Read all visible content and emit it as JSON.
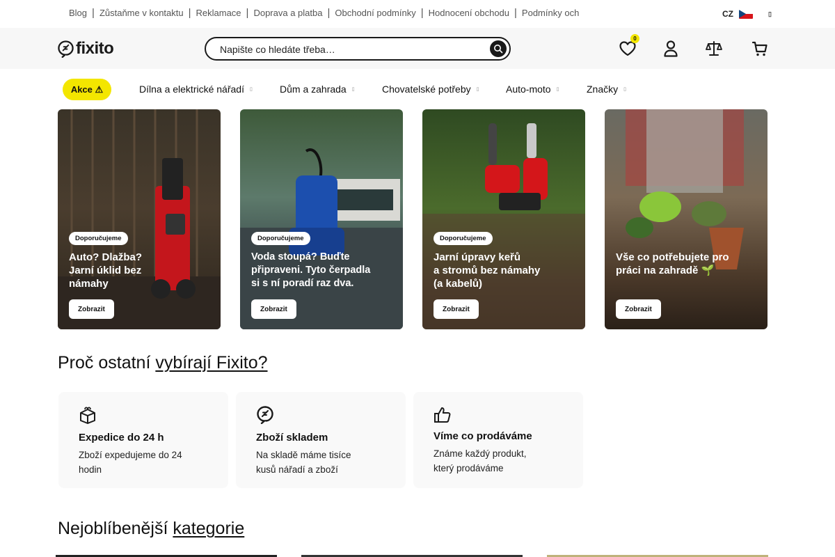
{
  "topbar": {
    "links": [
      "Blog",
      "Zůstaňme v kontaktu",
      "Reklamace",
      "Doprava a platba",
      "Obchodní podmínky",
      "Hodnocení obchodu",
      "Podmínky och"
    ],
    "lang": "CZ"
  },
  "header": {
    "logo": "fixito",
    "search_placeholder": "Napište co hledáte třeba…",
    "wishlist_count": "0"
  },
  "nav": {
    "akce": "Akce ⚠",
    "items": [
      "Dílna a elektrické nářadí",
      "Dům a zahrada",
      "Chovatelské potřeby",
      "Auto-moto",
      "Značky"
    ]
  },
  "banners": [
    {
      "tag": "Doporučujeme",
      "title": "Auto? Dlažba?\nJarní úklid bez\nnámahy",
      "button": "Zobrazit"
    },
    {
      "tag": "Doporučujeme",
      "title": "Voda stoupá? Buďte\npřipraveni. Tyto čerpadla\nsi s ní poradí raz dva.",
      "button": "Zobrazit"
    },
    {
      "tag": "Doporučujeme",
      "title": "Jarní úpravy keřů\na stromů bez námahy\n(a kabelů)",
      "button": "Zobrazit"
    },
    {
      "tag": "",
      "title": "Vše co potřebujete pro\npráci na zahradě 🌱",
      "button": "Zobrazit"
    }
  ],
  "why": {
    "title_plain": "Proč ostatní ",
    "title_link": "vybírají Fixito?",
    "cards": [
      {
        "icon": "box-icon",
        "title": "Expedice do 24 h",
        "desc": "Zboží expedujeme do 24 hodin"
      },
      {
        "icon": "fixito-mark-icon",
        "title": "Zboží skladem",
        "desc": "Na skladě máme tisíce kusů nářadí a zboží"
      },
      {
        "icon": "thumbs-up-icon",
        "title": "Víme co prodáváme",
        "desc": "Známe každý produkt, který prodáváme"
      }
    ]
  },
  "categories": {
    "title_plain": "Nejoblíbenější ",
    "title_link": "kategorie"
  },
  "colors": {
    "accent_yellow": "#f3e600",
    "dark": "#1a1a1a"
  }
}
